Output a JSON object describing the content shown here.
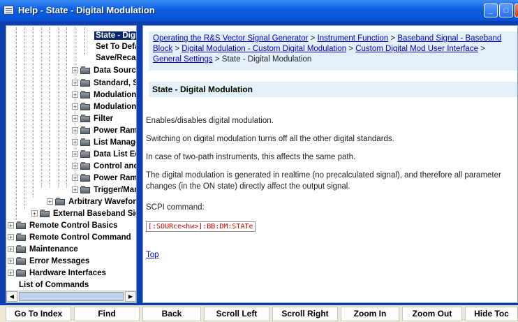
{
  "window": {
    "title": "Help - State - Digital Modulation",
    "minimize": "_",
    "maximize": "□"
  },
  "toc": {
    "items": [
      {
        "label": "State - Digi",
        "selected": true
      },
      {
        "label": "Set To Defa"
      },
      {
        "label": "Save/Recal"
      },
      {
        "label": "Data Sourc"
      },
      {
        "label": "Standard, S"
      },
      {
        "label": "Modulation"
      },
      {
        "label": "Modulation"
      },
      {
        "label": "Filter"
      },
      {
        "label": "Power Ram"
      },
      {
        "label": "List Manage"
      },
      {
        "label": "Data List Ed"
      },
      {
        "label": "Control and"
      },
      {
        "label": "Power Ram"
      },
      {
        "label": "Trigger/Mar"
      },
      {
        "label": "Arbitrary Wavefor"
      },
      {
        "label": "External Baseband Sig"
      },
      {
        "label": "Remote Control Basics"
      },
      {
        "label": "Remote Control Command"
      },
      {
        "label": "Maintenance"
      },
      {
        "label": "Error Messages"
      },
      {
        "label": "Hardware Interfaces"
      },
      {
        "label": "List of Commands"
      }
    ]
  },
  "breadcrumb": {
    "link1": "Operating the R&S Vector Signal Generator",
    "sep": " > ",
    "link2": "Instrument Function",
    "link3": "Baseband Signal - Baseband Block",
    "link4": "Digital Modulation - Custom Digital Modulation",
    "link5": "Custom Digital Mod User Interface",
    "link6": "General Settings",
    "current": "State - Digital Modulation"
  },
  "page": {
    "heading": "State - Digital Modulation",
    "p1": "Enables/disables digital modulation.",
    "p2": "Switching on digital modulation turns off all the other digital standards.",
    "p3": "In case of two-path instruments, this affects the same path.",
    "p4": "The digital modulation is generated in realtime (no precalculated signal), and therefore all parameter changes (in the ON state) directly affect the output signal.",
    "p5": "SCPI command:",
    "scpi": "[:SOURce<hw>]:BB:DM:STATe",
    "top_link": "Top"
  },
  "buttons": {
    "go_to_index": "Go To Index",
    "find": "Find",
    "back": "Back",
    "scroll_left": "Scroll Left",
    "scroll_right": "Scroll Right",
    "zoom_in": "Zoom In",
    "zoom_out": "Zoom Out",
    "hide_toc": "Hide Toc"
  },
  "colors": {
    "frame": "#0a3fb0",
    "link": "#0000cc",
    "scpi": "#d00000",
    "panel": "#e4effa"
  }
}
